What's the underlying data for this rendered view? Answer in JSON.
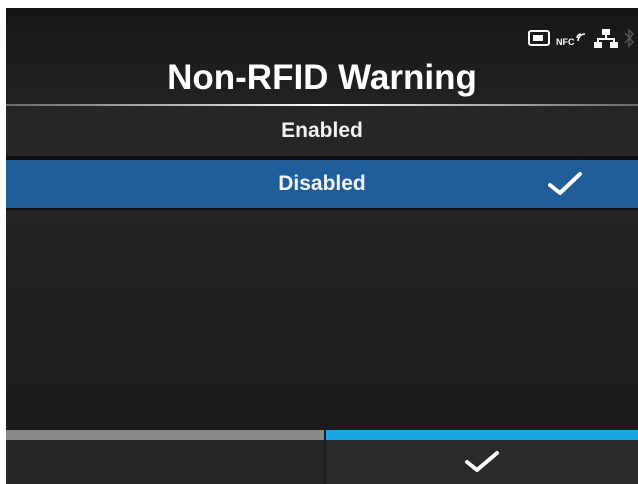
{
  "header": {
    "title": "Non-RFID Warning",
    "status_icons": [
      {
        "name": "memory-card-icon"
      },
      {
        "name": "nfc-icon",
        "text": "NFC"
      },
      {
        "name": "network-icon"
      },
      {
        "name": "bluetooth-icon"
      }
    ]
  },
  "options": [
    {
      "label": "Enabled",
      "selected": false
    },
    {
      "label": "Disabled",
      "selected": true
    }
  ],
  "footer": {
    "left_button": "",
    "right_button_icon": "checkmark-icon"
  },
  "colors": {
    "selected_row": "#1f5e9a",
    "confirm_bar": "#1aa5e6",
    "back_bar": "#8a8a8a"
  }
}
